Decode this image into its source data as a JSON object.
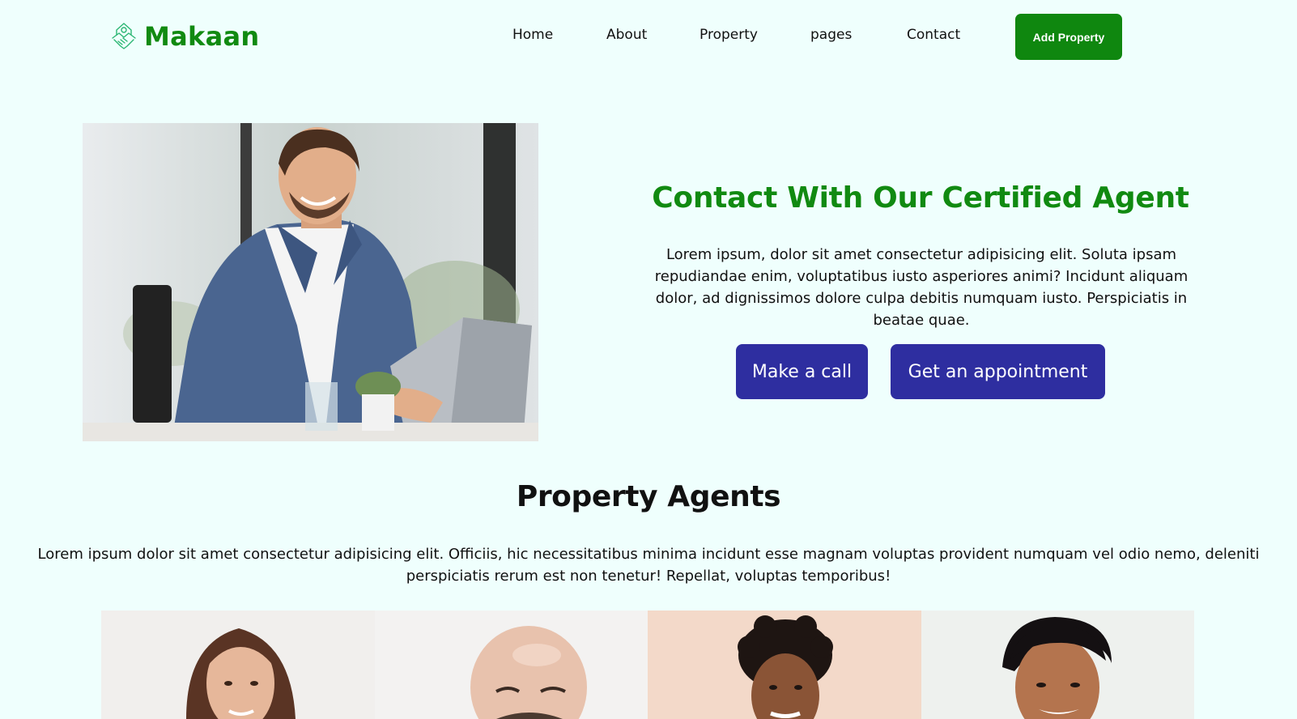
{
  "brand": {
    "name": "Makaan",
    "color": "#118a11"
  },
  "nav": {
    "items": [
      {
        "label": "Home"
      },
      {
        "label": "About"
      },
      {
        "label": "Property"
      },
      {
        "label": "pages"
      },
      {
        "label": "Contact"
      }
    ],
    "cta_label": "Add Property"
  },
  "hero": {
    "title": "Contact With Our Certified Agent",
    "text": "Lorem ipsum, dolor sit amet consectetur adipisicing elit. Soluta ipsam repudiandae enim, voluptatibus iusto asperiores animi? Incidunt aliquam dolor, ad dignissimos dolore culpa debitis numquam iusto. Perspiciatis in beatae quae.",
    "call_label": "Make a call",
    "appointment_label": "Get an appointment"
  },
  "agents_section": {
    "title": "Property Agents",
    "text": "Lorem ipsum dolor sit amet consectetur adipisicing elit. Officiis, hic necessitatibus minima incidunt esse magnam voluptas provident numquam vel odio nemo, deleniti perspiciatis rerum est non tenetur! Repellat, voluptas temporibus!"
  },
  "colors": {
    "background": "#effffd",
    "accent_green": "#0f870f",
    "button_blue": "#2e2ea0"
  }
}
